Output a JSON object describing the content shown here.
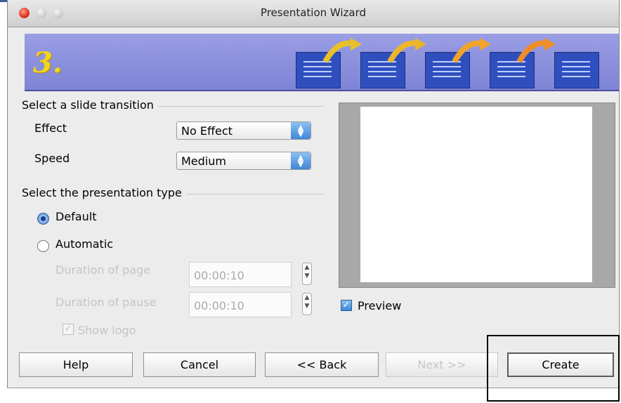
{
  "window": {
    "title": "Presentation Wizard",
    "step_number": "3."
  },
  "transition": {
    "section_label": "Select a slide transition",
    "effect_label": "Effect",
    "effect_value": "No Effect",
    "speed_label": "Speed",
    "speed_value": "Medium"
  },
  "presentation_type": {
    "section_label": "Select the presentation type",
    "option_default": "Default",
    "option_automatic": "Automatic",
    "selected": "Default",
    "duration_page_label": "Duration of page",
    "duration_page_value": "00:00:10",
    "duration_pause_label": "Duration of pause",
    "duration_pause_value": "00:00:10",
    "show_logo_label": "Show logo",
    "show_logo_checked": true
  },
  "preview": {
    "label": "Preview",
    "checked": true
  },
  "buttons": {
    "help": "Help",
    "cancel": "Cancel",
    "back": "<< Back",
    "next": "Next >>",
    "create": "Create"
  },
  "colors": {
    "banner": "#8e92de",
    "step_number": "#f2d41e",
    "slide_icon": "#2f4fbf",
    "accent": "#3f87d8"
  },
  "icons": {
    "step_banner": [
      "slide-icon",
      "arrow-icon",
      "slide-icon",
      "arrow-icon",
      "slide-icon",
      "arrow-icon",
      "slide-icon",
      "arrow-icon",
      "slide-icon"
    ],
    "select_arrows": "up-down-arrows-icon",
    "spinner": "spin-icon"
  }
}
